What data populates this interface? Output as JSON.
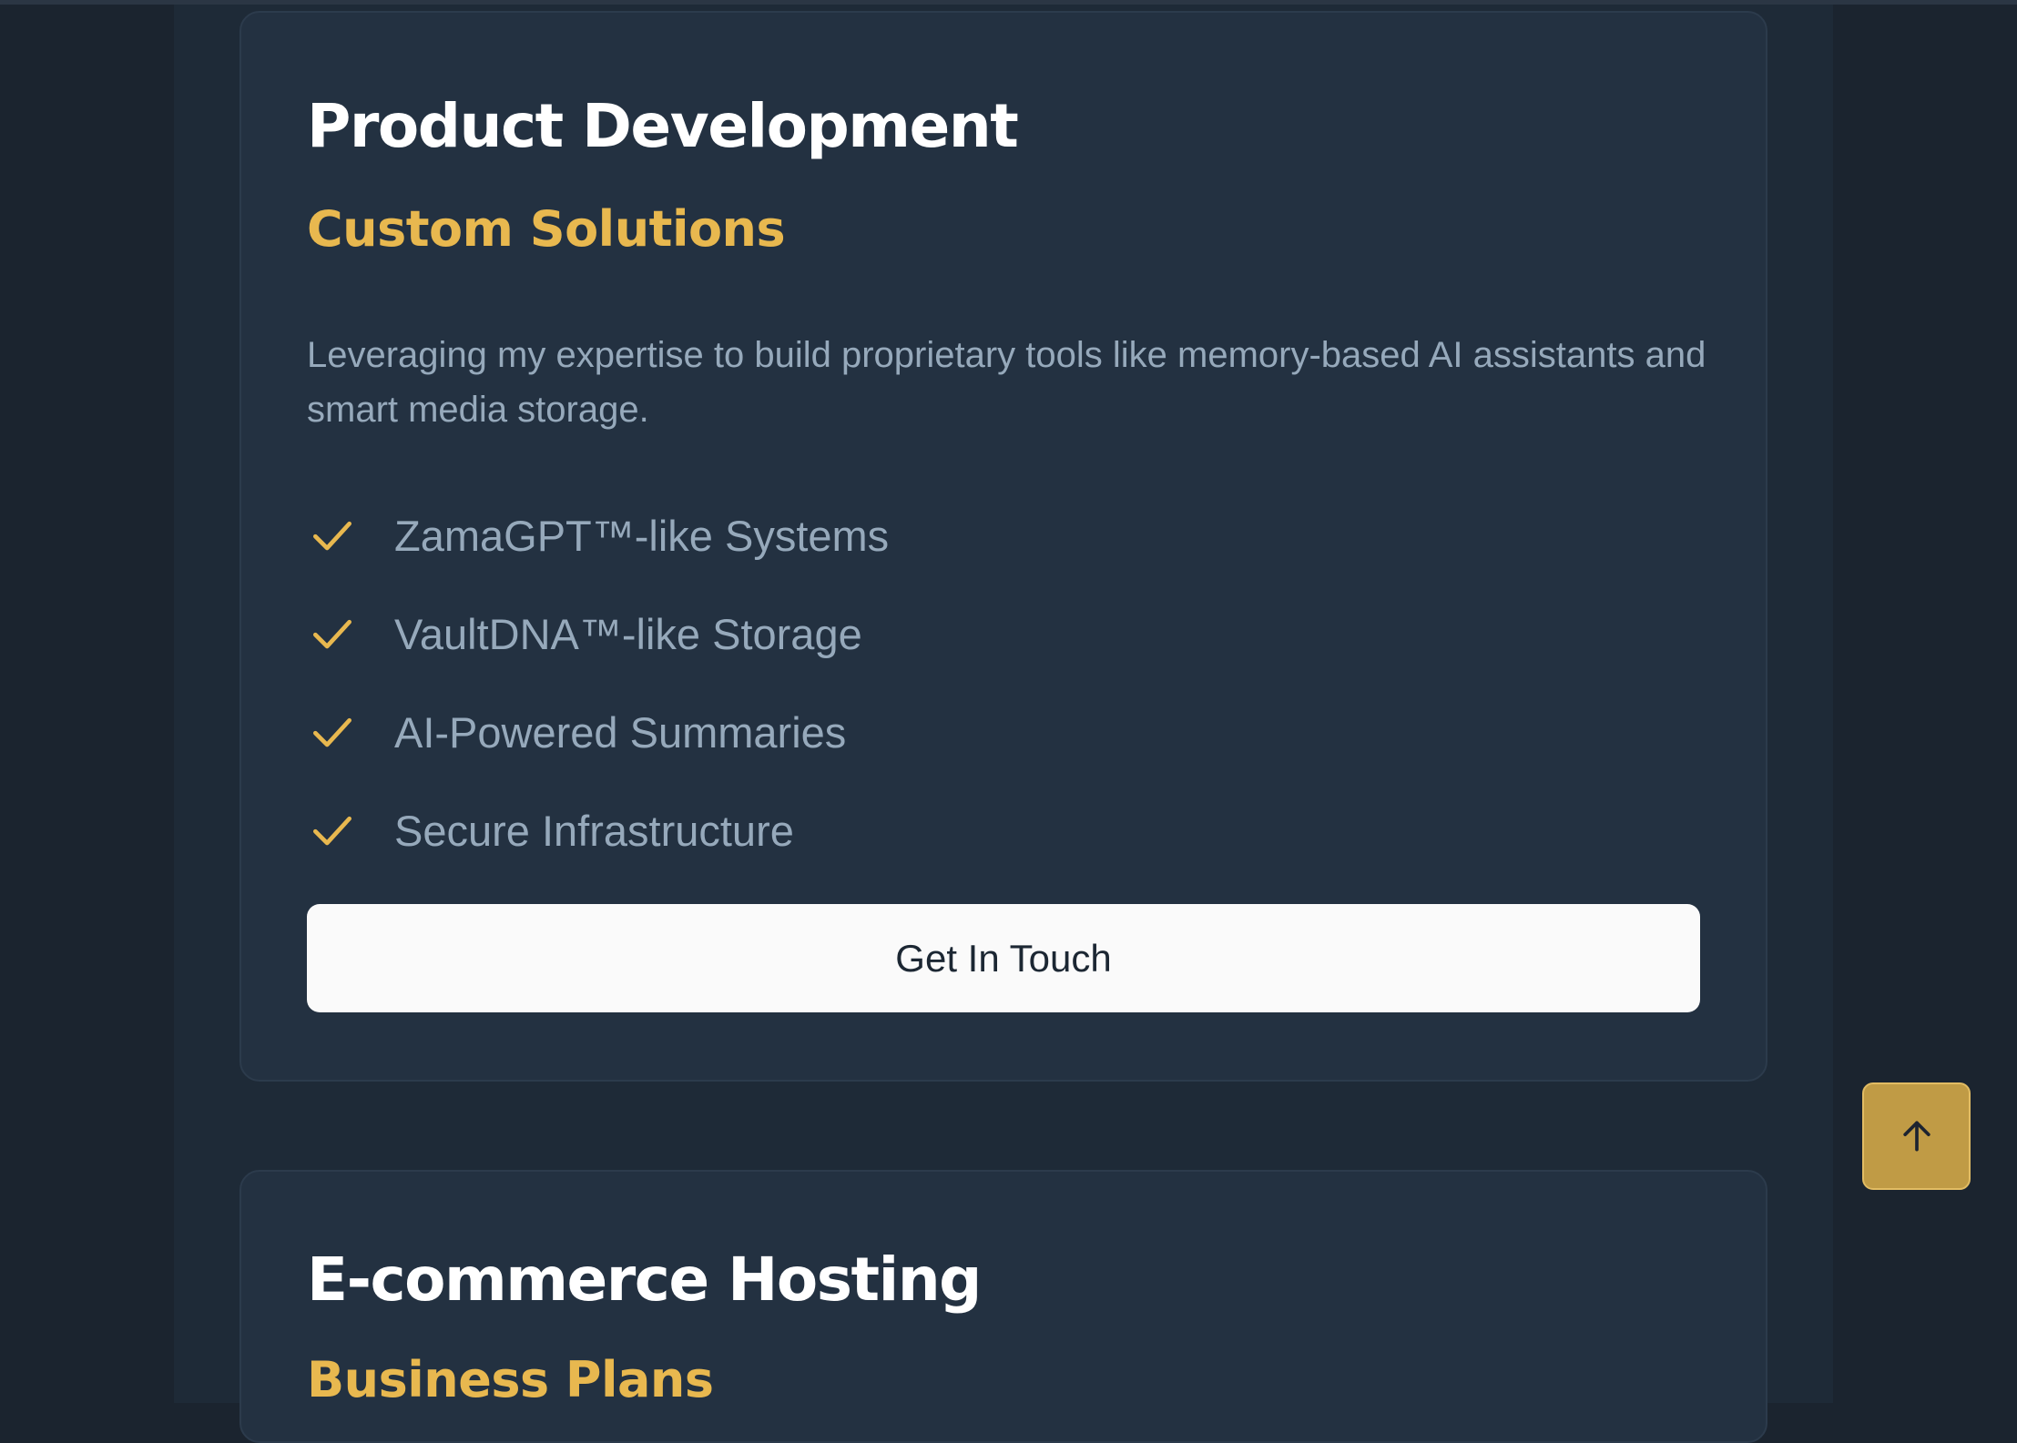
{
  "cards": [
    {
      "title": "Product Development",
      "subtitle": "Custom Solutions",
      "description": "Leveraging my expertise to build proprietary tools like memory-based AI assistants and smart media storage.",
      "features": [
        "ZamaGPT™-like Systems",
        "VaultDNA™-like Storage",
        "AI-Powered Summaries",
        "Secure Infrastructure"
      ],
      "button_label": "Get In Touch"
    },
    {
      "title": "E-commerce Hosting",
      "subtitle": "Business Plans"
    }
  ],
  "icons": {
    "feature": "check-icon",
    "scroll_top": "arrow-up-icon"
  },
  "colors": {
    "background": "#1b242f",
    "card": "#233141",
    "accent": "#e8b84f",
    "muted_text": "#96a9bb",
    "button_bg": "#fafafa",
    "scroll_top_bg": "#c09b45"
  }
}
